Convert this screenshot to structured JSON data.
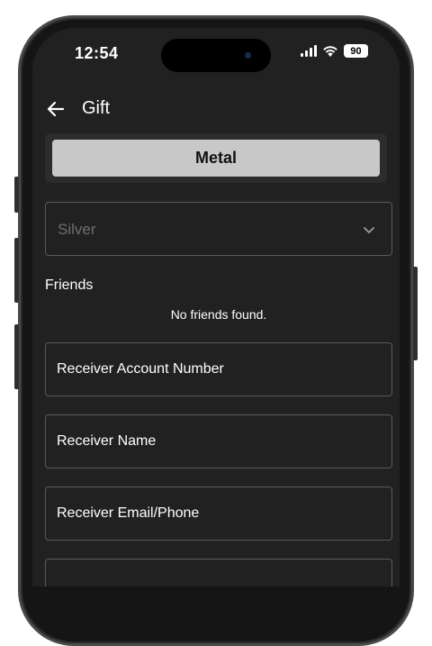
{
  "status_bar": {
    "time": "12:54",
    "battery": "90"
  },
  "app_bar": {
    "title": "Gift"
  },
  "tabs": [
    {
      "label": "Metal",
      "selected": true
    }
  ],
  "metal_select": {
    "value": "Silver"
  },
  "friends": {
    "label": "Friends",
    "empty_message": "No friends found."
  },
  "fields": {
    "account_number": "Receiver Account Number",
    "name": "Receiver Name",
    "email_phone": "Receiver Email/Phone"
  },
  "colors": {
    "background": "#212121",
    "tab_active": "#c8c8c8",
    "border": "#5a5a5a",
    "text": "#ffffff",
    "placeholder": "#6e6e6e"
  }
}
